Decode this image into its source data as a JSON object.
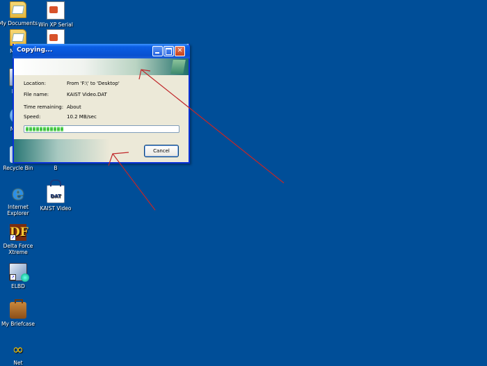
{
  "desktop": {
    "background_color": "#004e98",
    "icons": [
      {
        "label": "My Documents",
        "icon": "my-documents-icon"
      },
      {
        "label": "Win XP Serial",
        "icon": "text-document-icon"
      },
      {
        "label": "My Do",
        "icon": "my-documents-icon"
      },
      {
        "label": "",
        "icon": "text-document-icon"
      },
      {
        "label": "My C",
        "icon": "my-computer-icon"
      },
      {
        "label": "My I P",
        "icon": "network-places-icon"
      },
      {
        "label": "Recycle Bin",
        "icon": "recycle-bin-icon"
      },
      {
        "label": "B",
        "icon": "file-icon"
      },
      {
        "label": "Internet Explorer",
        "icon": "internet-explorer-icon"
      },
      {
        "label": "KAIST Video",
        "icon": "dat-file-icon"
      },
      {
        "label": "Delta Force Xtreme",
        "icon": "delta-force-icon"
      },
      {
        "label": "ELBD",
        "icon": "elbd-icon"
      },
      {
        "label": "My Briefcase",
        "icon": "briefcase-icon"
      },
      {
        "label": "Net",
        "icon": "net-icon"
      }
    ]
  },
  "dialog": {
    "title": "Copying...",
    "location_label": "Location:",
    "location_value": "From 'F:\\' to 'Desktop'",
    "filename_label": "File name:",
    "filename_value": "KAIST Video.DAT",
    "time_label": "Time remaining:",
    "time_value": "About",
    "speed_label": "Speed:",
    "speed_value": "10.2 MB/sec",
    "progress_fraction": 0.25,
    "cancel_label": "Cancel"
  },
  "annotation_arrow_color": "#c0282a"
}
